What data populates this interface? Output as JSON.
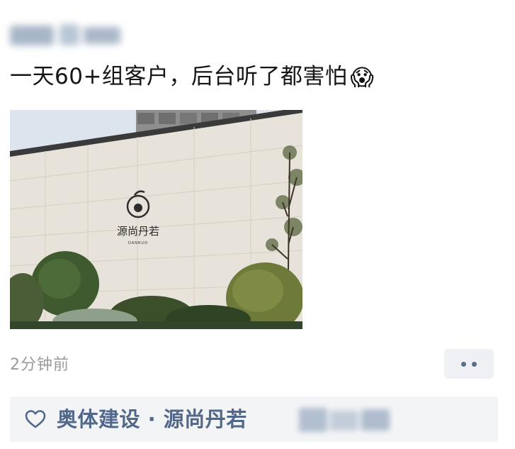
{
  "post": {
    "text": "一天60+组客户，后台听了都害怕",
    "emoji": "😱",
    "photo_sign_text": "源尚丹若",
    "photo_sign_subtext": "DANRUO",
    "timestamp": "2分钟前"
  },
  "likes": {
    "names": "奥体建设 · 源尚丹若",
    "icon": "heart-outline-icon"
  },
  "colors": {
    "link_blue": "#51688a",
    "timestamp_gray": "#9a9a9a",
    "likes_bar_bg": "#f3f4f6"
  }
}
